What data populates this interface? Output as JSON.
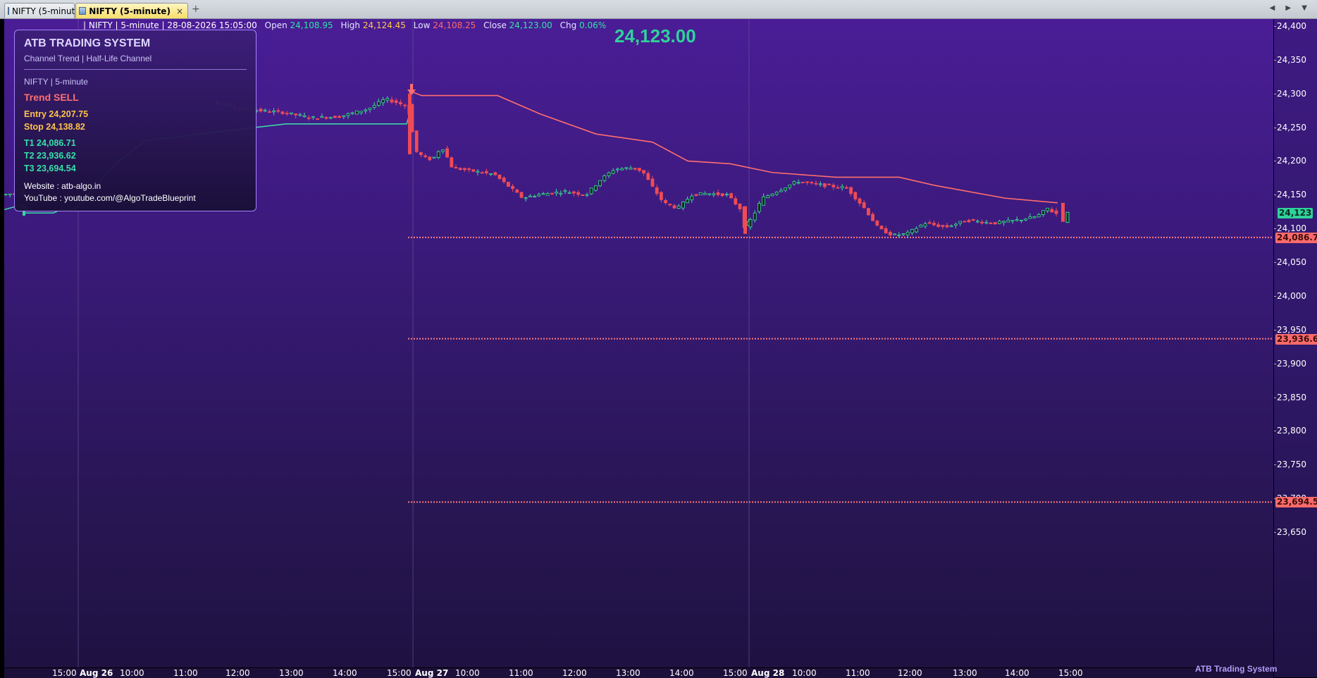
{
  "tabs": [
    {
      "label": "NIFTY (5-minute)",
      "active": false
    },
    {
      "label": "NIFTY (5-minute)",
      "active": true,
      "close": "×"
    }
  ],
  "new_tab_icon": "+",
  "tab_nav_icons": "◀ ▶ ▼",
  "quote": {
    "prefix": "| NIFTY | 5-minute | 28-08-2026 15:05:00",
    "open_label": "Open",
    "open": "24,108.95",
    "high_label": "High",
    "high": "24,124.45",
    "low_label": "Low",
    "low": "24,108.25",
    "close_label": "Close",
    "close": "24,123.00",
    "chg_label": "Chg",
    "chg": "0.06%"
  },
  "last_price": "24,123.00",
  "info": {
    "title": "ATB TRADING SYSTEM",
    "subtitle": "Channel Trend  |  Half-Life Channel",
    "symbol_line": "NIFTY   |   5-minute",
    "trend": "Trend  SELL",
    "entry": "Entry  24,207.75",
    "stop": "Stop   24,138.82",
    "t1": "T1  24,086.71",
    "t2": "T2  23,936.62",
    "t3": "T3  23,694.54",
    "website": "Website : atb-algo.in",
    "youtube": "YouTube : youtube.com/@AlgoTradeBlueprint"
  },
  "colors": {
    "bull": "#3ddc9a",
    "bear": "#ef4b55",
    "trail_up": "#3ad6a6",
    "trail_down": "#ff6e6e",
    "target_line": "#ff7a7a"
  },
  "price_axis": {
    "ticks": [
      "24,400",
      "24,350",
      "24,300",
      "24,250",
      "24,200",
      "24,150",
      "24,100",
      "24,050",
      "24,000",
      "23,950",
      "23,900",
      "23,850",
      "23,800",
      "23,750",
      "23,700",
      "23,650"
    ],
    "last_label": "24,123",
    "t1_label": "24,086.7",
    "t2_label": "23,936.6",
    "t3_label": "23,694.5"
  },
  "time_axis": [
    {
      "label": "15:00",
      "bold": false
    },
    {
      "label": "Aug 26",
      "bold": true
    },
    {
      "label": "10:00",
      "bold": false
    },
    {
      "label": "11:00",
      "bold": false
    },
    {
      "label": "12:00",
      "bold": false
    },
    {
      "label": "13:00",
      "bold": false
    },
    {
      "label": "14:00",
      "bold": false
    },
    {
      "label": "15:00",
      "bold": false
    },
    {
      "label": "Aug 27",
      "bold": true
    },
    {
      "label": "10:00",
      "bold": false
    },
    {
      "label": "11:00",
      "bold": false
    },
    {
      "label": "12:00",
      "bold": false
    },
    {
      "label": "13:00",
      "bold": false
    },
    {
      "label": "14:00",
      "bold": false
    },
    {
      "label": "15:00",
      "bold": false
    },
    {
      "label": "Aug 28",
      "bold": true
    },
    {
      "label": "10:00",
      "bold": false
    },
    {
      "label": "11:00",
      "bold": false
    },
    {
      "label": "12:00",
      "bold": false
    },
    {
      "label": "13:00",
      "bold": false
    },
    {
      "label": "14:00",
      "bold": false
    },
    {
      "label": "15:00",
      "bold": false
    }
  ],
  "watermark": "ATB Trading System",
  "chart_data": {
    "type": "candlestick",
    "symbol": "NIFTY",
    "interval": "5-minute",
    "ylim": [
      23630,
      24415
    ],
    "levels": {
      "t1": 24086.71,
      "t2": 23936.62,
      "t3": 23694.54
    },
    "day_closes": [
      {
        "session": "Aug 26",
        "close_approx": 24275
      },
      {
        "session": "Aug 27",
        "close_approx": 24095
      },
      {
        "session": "Aug 28",
        "close": 24123.0
      }
    ],
    "last_bar": {
      "time": "28-08-2026 15:05:00",
      "open": 24108.95,
      "high": 24124.45,
      "low": 24108.25,
      "close": 24123.0
    }
  }
}
